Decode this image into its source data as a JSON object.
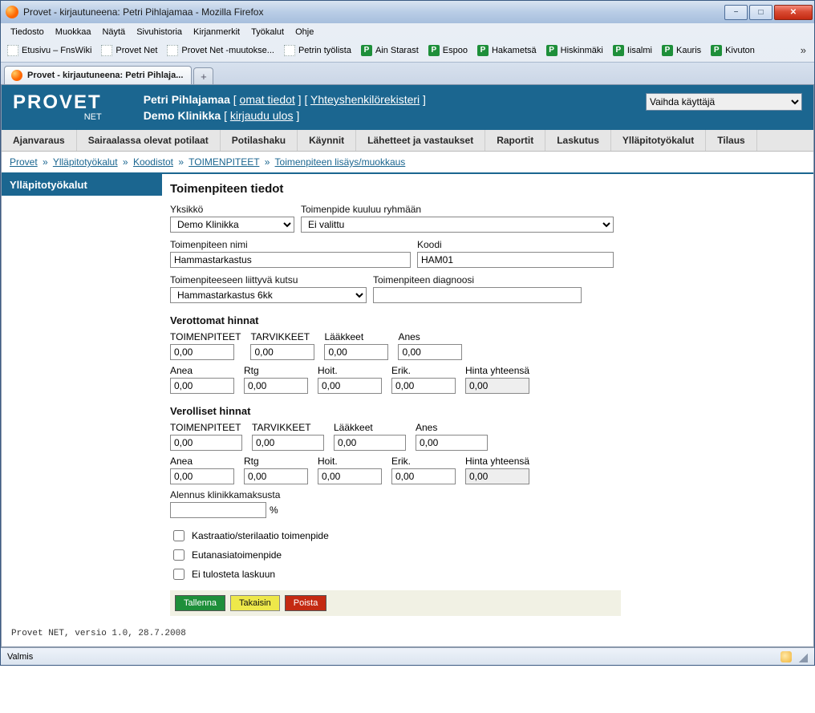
{
  "window": {
    "title": "Provet - kirjautuneena: Petri Pihlajamaa - Mozilla Firefox"
  },
  "menus": [
    "Tiedosto",
    "Muokkaa",
    "Näytä",
    "Sivuhistoria",
    "Kirjanmerkit",
    "Työkalut",
    "Ohje"
  ],
  "bookmarks_plain": [
    "Etusivu – FnsWiki",
    "Provet Net",
    "Provet Net -muutokse...",
    "Petrin työlista"
  ],
  "bookmarks_p": [
    "Ain Starast",
    "Espoo",
    "Hakametsä",
    "Hiskinmäki",
    "Iisalmi",
    "Kauris",
    "Kivuton"
  ],
  "bookmarks_overflow": "»",
  "tab": {
    "title": "Provet - kirjautuneena: Petri Pihlaja..."
  },
  "app": {
    "logo": "PROVET",
    "logo_sub": "NET",
    "user_name": "Petri Pihlajamaa",
    "own_info": "omat tiedot",
    "contacts": "Yhteyshenkilörekisteri",
    "clinic_label": "Demo Klinikka",
    "logout": "kirjaudu ulos",
    "switch_user": "Vaihda käyttäjä"
  },
  "nav": [
    "Ajanvaraus",
    "Sairaalassa olevat potilaat",
    "Potilashaku",
    "Käynnit",
    "Lähetteet ja vastaukset",
    "Raportit",
    "Laskutus",
    "Ylläpitotyökalut",
    "Tilaus"
  ],
  "crumbs": {
    "c0": "Provet",
    "c1": "Ylläpitotyökalut",
    "c2": "Koodistot",
    "c3": "TOIMENPITEET",
    "c4": "Toimenpiteen lisäys/muokkaus",
    "sep": "»"
  },
  "side": {
    "heading": "Ylläpitotyökalut"
  },
  "form": {
    "title": "Toimenpiteen tiedot",
    "unit_label": "Yksikkö",
    "unit_value": "Demo Klinikka",
    "group_label": "Toimenpide kuuluu ryhmään",
    "group_value": "Ei valittu",
    "name_label": "Toimenpiteen nimi",
    "name_value": "Hammastarkastus",
    "code_label": "Koodi",
    "code_value": "HAM01",
    "call_label": "Toimenpiteeseen liittyvä kutsu",
    "call_value": "Hammastarkastus 6kk",
    "diag_label": "Toimenpiteen diagnoosi",
    "diag_value": ""
  },
  "prices_novat": {
    "heading": "Verottomat hinnat",
    "cols1": [
      "TOIMENPITEET",
      "TARVIKKEET",
      "Lääkkeet",
      "Anes"
    ],
    "vals1": [
      "0,00",
      "0,00",
      "0,00",
      "0,00"
    ],
    "cols2": [
      "Anea",
      "Rtg",
      "Hoit.",
      "Erik.",
      "Hinta yhteensä"
    ],
    "vals2": [
      "0,00",
      "0,00",
      "0,00",
      "0,00",
      "0,00"
    ]
  },
  "prices_vat": {
    "heading": "Verolliset hinnat",
    "cols1": [
      "TOIMENPITEET",
      "TARVIKKEET",
      "Lääkkeet",
      "Anes"
    ],
    "vals1": [
      "0,00",
      "0,00",
      "0,00",
      "0,00"
    ],
    "cols2": [
      "Anea",
      "Rtg",
      "Hoit.",
      "Erik.",
      "Hinta yhteensä"
    ],
    "vals2": [
      "0,00",
      "0,00",
      "0,00",
      "0,00",
      "0,00"
    ]
  },
  "discount": {
    "label": "Alennus klinikkamaksusta",
    "suffix": "%",
    "value": ""
  },
  "checks": {
    "c1": "Kastraatio/sterilaatio toimenpide",
    "c2": "Eutanasiatoimenpide",
    "c3": "Ei tulosteta laskuun"
  },
  "buttons": {
    "save": "Tallenna",
    "back": "Takaisin",
    "delete": "Poista"
  },
  "footer": {
    "version": "Provet NET, versio 1.0, 28.7.2008"
  },
  "status": {
    "text": "Valmis"
  }
}
